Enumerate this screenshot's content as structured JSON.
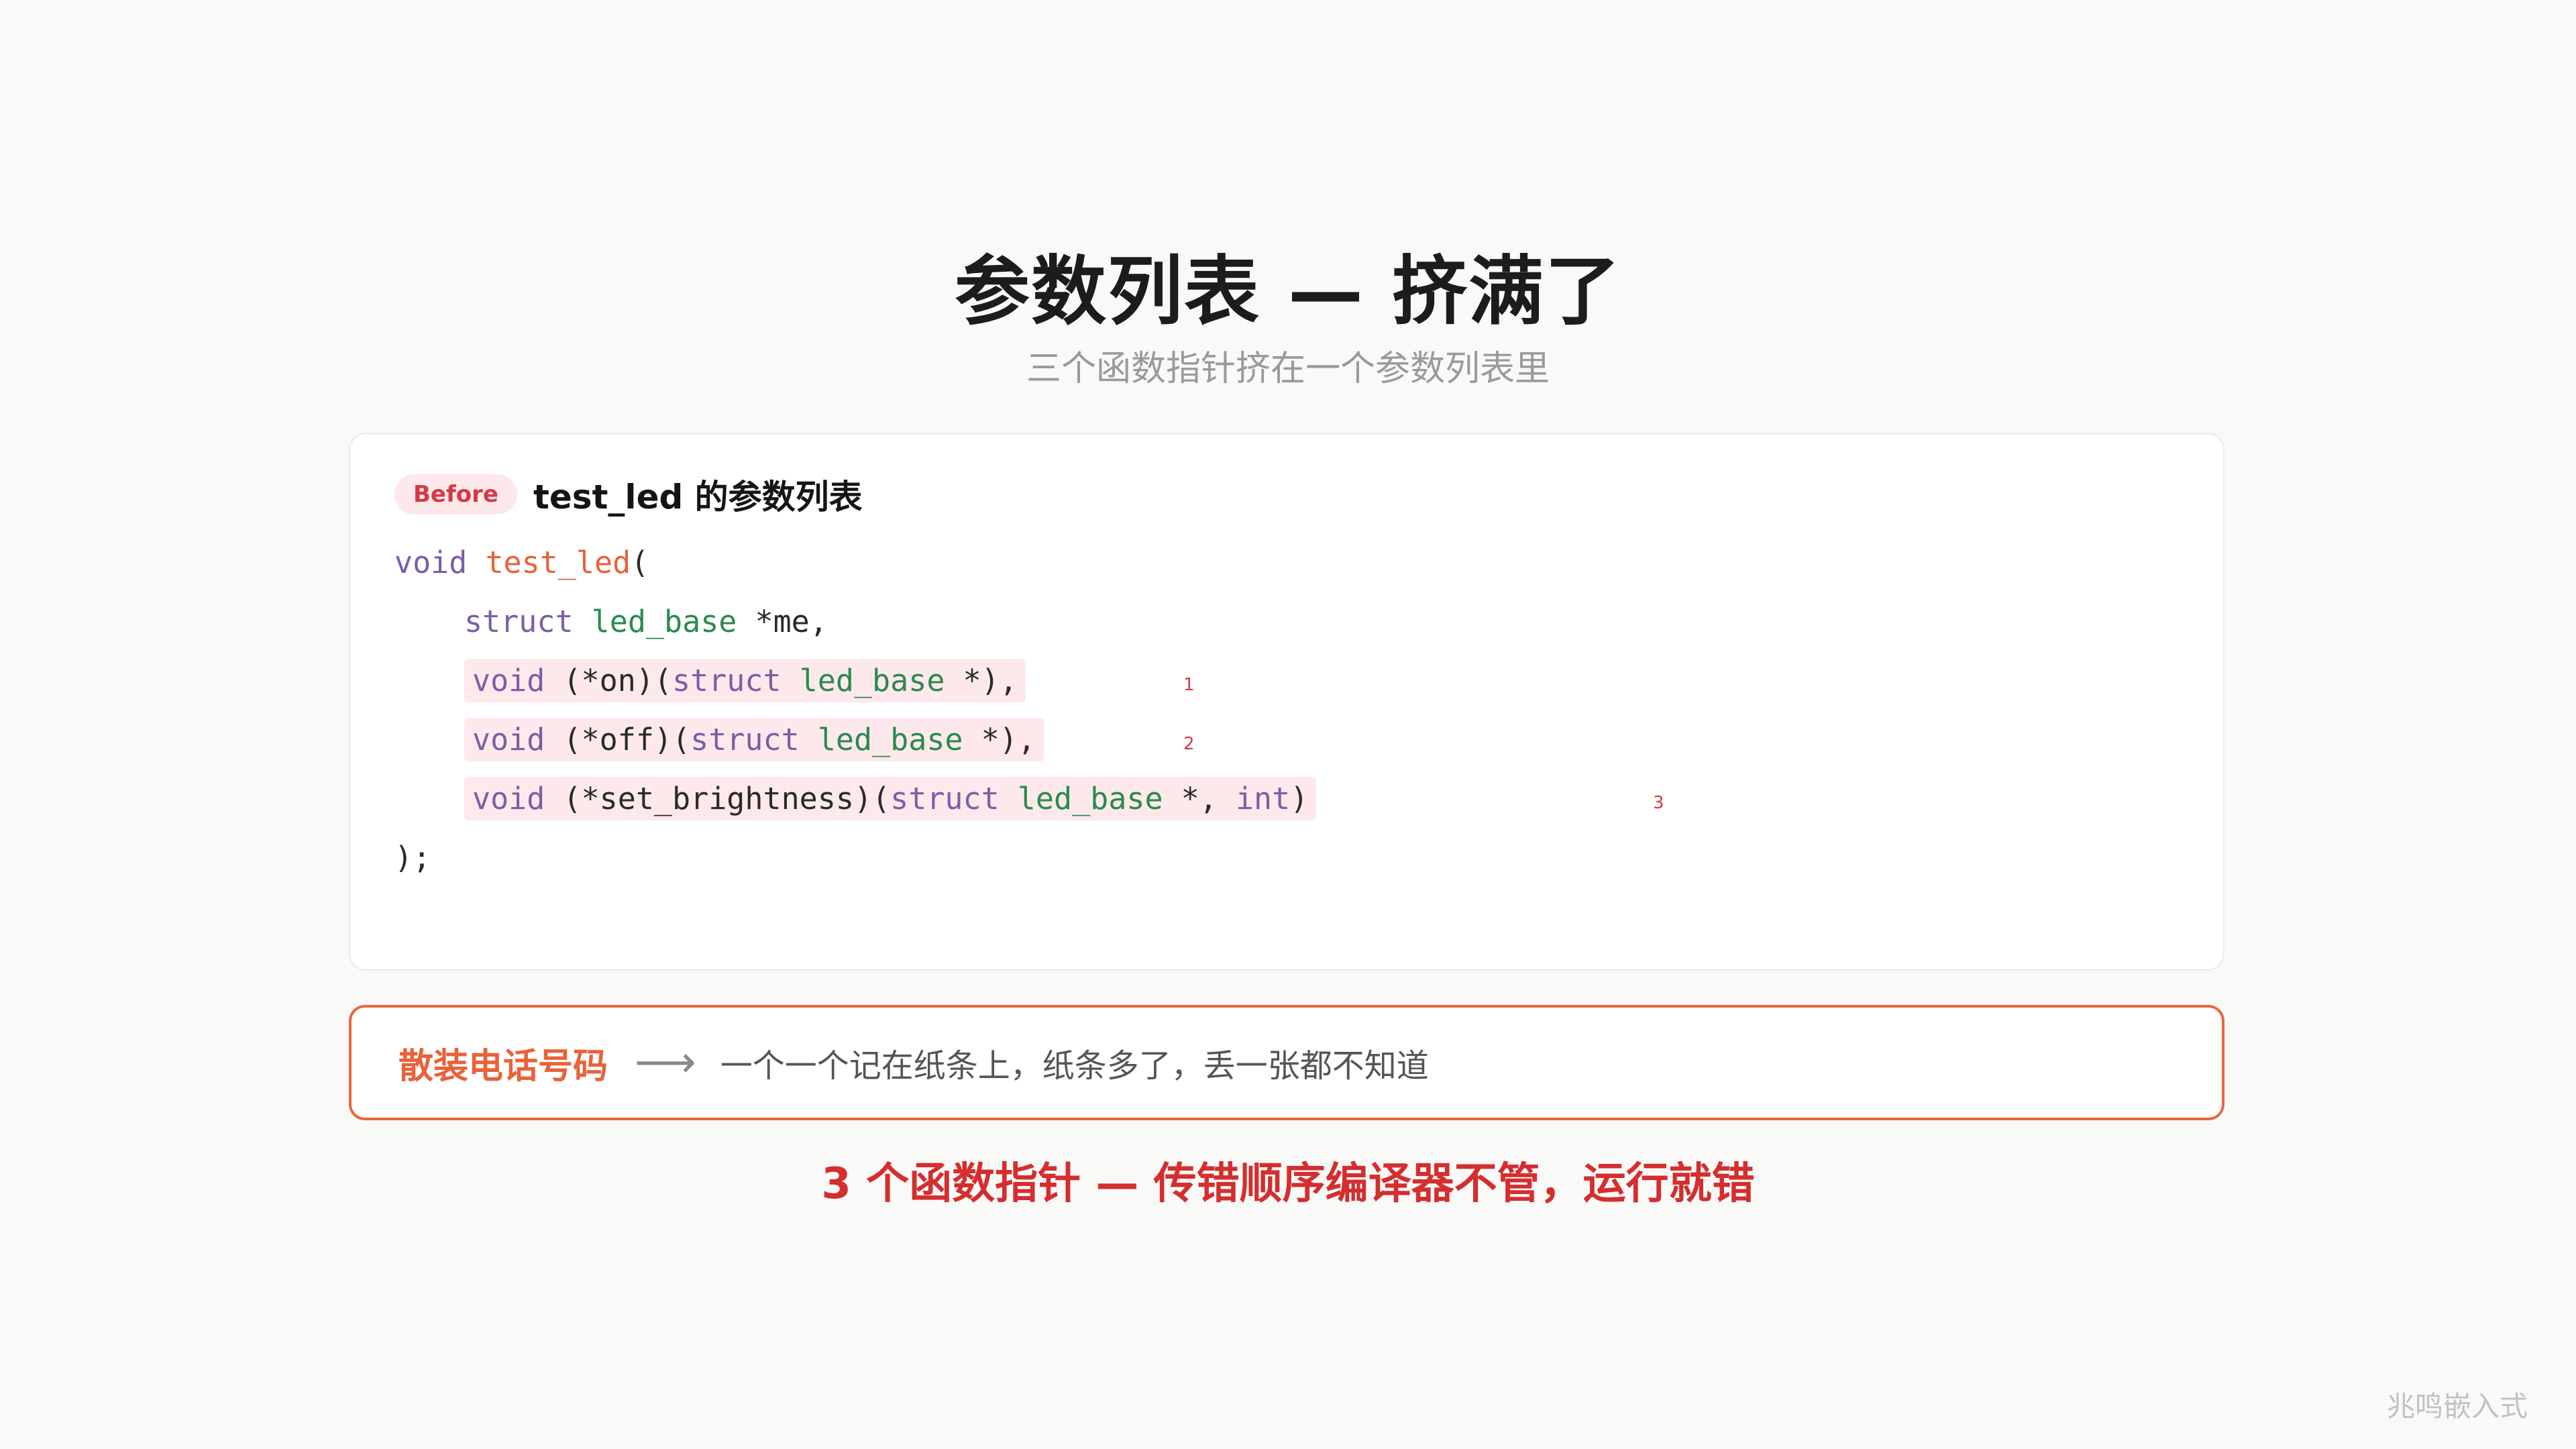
{
  "slide": {
    "title": "参数列表 — 挤满了",
    "subtitle": "三个函数指针挤在一个参数列表里"
  },
  "card": {
    "badge": "Before",
    "title": "test_led 的参数列表",
    "code": {
      "l1_kw": "void",
      "l1_fn": "test_led",
      "l1_tail": "(",
      "l2_kw": "struct",
      "l2_ty": "led_base",
      "l2_tail": " *me,",
      "l3_kw": "void",
      "l3_mid": " (*on)(",
      "l3_kw2": "struct",
      "l3_ty": "led_base",
      "l3_tail": " *),",
      "l3_num": "1",
      "l4_kw": "void",
      "l4_mid": " (*off)(",
      "l4_kw2": "struct",
      "l4_ty": "led_base",
      "l4_tail": " *),",
      "l4_num": "2",
      "l5_kw": "void",
      "l5_mid": " (*set_brightness)(",
      "l5_kw2": "struct",
      "l5_ty": "led_base",
      "l5_mid2": " *, ",
      "l5_kw3": "int",
      "l5_tail": ")",
      "l5_num": "3",
      "l6": ");"
    }
  },
  "callout": {
    "label": "散装电话号码",
    "arrow": "⟶",
    "text": "一个一个记在纸条上，纸条多了，丢一张都不知道"
  },
  "warning": "3 个函数指针 — 传错顺序编译器不管，运行就错",
  "watermark": "兆鸣嵌入式",
  "colors": {
    "accent": "#e8623a",
    "danger": "#d42e2e",
    "keyword": "#7b5ea7",
    "type": "#2a8a4e",
    "highlight": "#fde9eb"
  }
}
